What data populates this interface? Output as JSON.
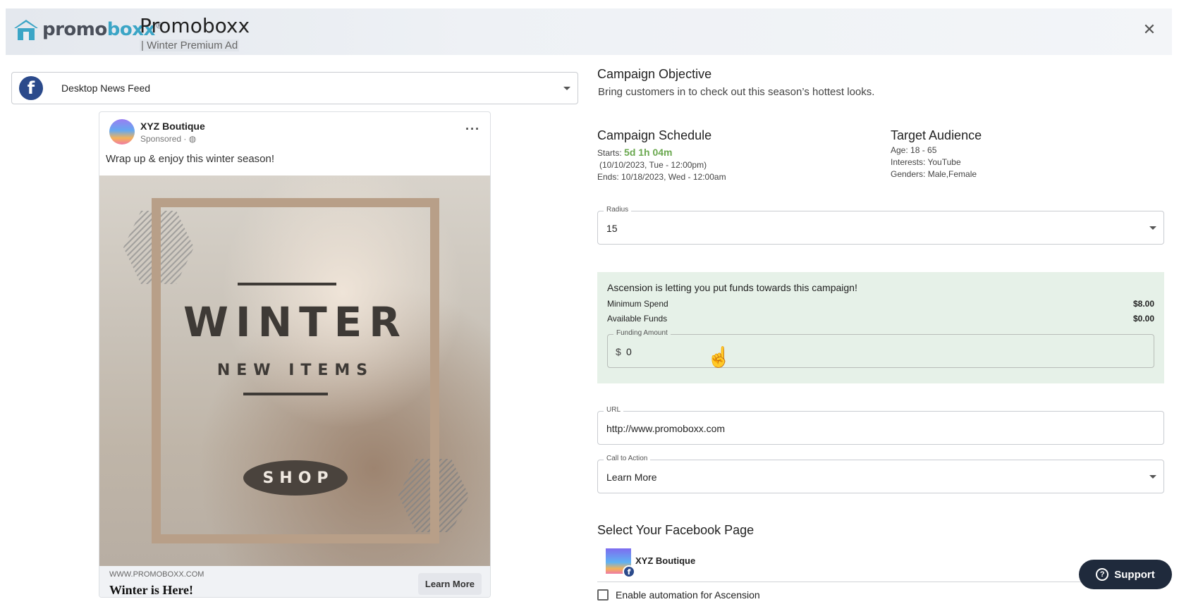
{
  "header": {
    "logo_text_1": "promo",
    "logo_text_2": "boxx",
    "logo_tm": "®",
    "title": "Promoboxx",
    "subtitle": "| Winter Premium Ad",
    "close_label": "✕"
  },
  "placement": {
    "label": "Desktop News Feed",
    "icon": "facebook-icon",
    "icon_glyph": "f"
  },
  "post": {
    "page_name": "XYZ Boutique",
    "sponsored": "Sponsored · ◍",
    "more_glyph": "···",
    "text": "Wrap up & enjoy this winter season!",
    "ad_headline": "WINTER",
    "ad_subheadline": "NEW ITEMS",
    "ad_button": "SHOP",
    "domain": "WWW.PROMOBOXX.COM",
    "headline": "Winter is Here!",
    "cta": "Learn More"
  },
  "objective": {
    "title": "Campaign Objective",
    "text": "Bring customers in to check out this season’s hottest looks."
  },
  "schedule": {
    "title": "Campaign Schedule",
    "starts_label": "Starts:",
    "countdown": "5d 1h 04m",
    "start_detail": "(10/10/2023, Tue - 12:00pm)",
    "ends": "Ends: 10/18/2023, Wed - 12:00am"
  },
  "audience": {
    "title": "Target Audience",
    "age": "Age: 18 - 65",
    "interests": "Interests: YouTube",
    "genders": "Genders: Male,Female"
  },
  "radius": {
    "label": "Radius",
    "value": "15"
  },
  "funds": {
    "heading": "Ascension is letting you put funds towards this campaign!",
    "min_label": "Minimum Spend",
    "min_value": "$8.00",
    "avail_label": "Available Funds",
    "avail_value": "$0.00",
    "amount_label": "Funding Amount",
    "currency": "$",
    "amount_value": "0"
  },
  "url": {
    "label": "URL",
    "value": "http://www.promoboxx.com"
  },
  "cta": {
    "label": "Call to Action",
    "value": "Learn More"
  },
  "fb_page": {
    "title": "Select Your Facebook Page",
    "name": "XYZ Boutique",
    "badge_glyph": "f"
  },
  "automation": {
    "label": "Enable automation for Ascension",
    "checked": false
  },
  "support": {
    "label": "Support",
    "icon_glyph": "?"
  },
  "colors": {
    "accent_green": "#6aa84f",
    "funds_bg": "#e6f1e8",
    "facebook_blue": "#2b4a8b",
    "support_bg": "#1f2a3c",
    "logo_blue": "#3ba5c6"
  }
}
